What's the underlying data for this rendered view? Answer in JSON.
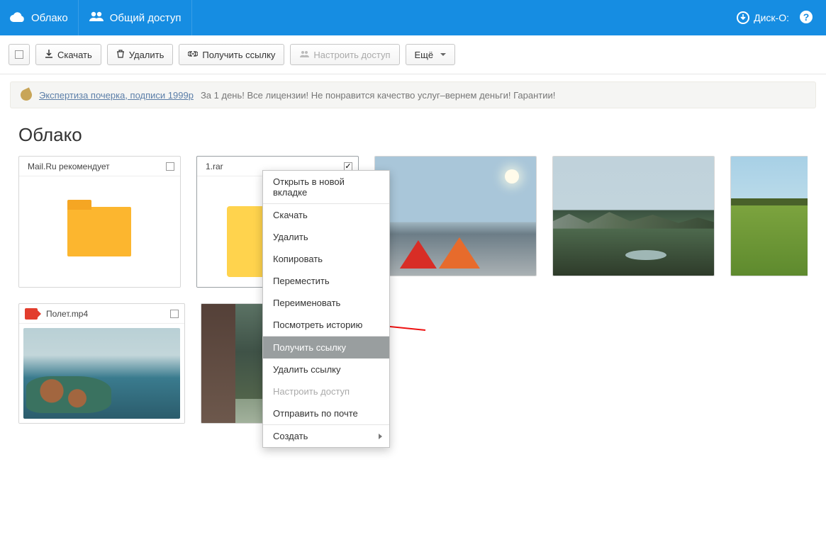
{
  "topbar": {
    "tab_cloud": "Облако",
    "tab_shared": "Общий доступ",
    "disk_label": "Диск-О:"
  },
  "toolbar": {
    "download": "Скачать",
    "delete": "Удалить",
    "getlink": "Получить ссылку",
    "configure_access": "Настроить доступ",
    "more": "Ещё"
  },
  "ad": {
    "link": "Экспертиза почерка, подписи 1999р",
    "text": "За 1 день! Все лицензии! Не понравится качество услуг–вернем деньги! Гарантии!"
  },
  "page_title": "Облако",
  "items": {
    "folder": {
      "title": "Mail.Ru рекомендует"
    },
    "archive": {
      "title": "1.rar"
    },
    "video": {
      "title": "Полет.mp4"
    }
  },
  "context_menu": [
    {
      "label": "Открыть в новой вкладке",
      "state": ""
    },
    {
      "label": "Скачать",
      "state": "sep"
    },
    {
      "label": "Удалить",
      "state": ""
    },
    {
      "label": "Копировать",
      "state": ""
    },
    {
      "label": "Переместить",
      "state": ""
    },
    {
      "label": "Переименовать",
      "state": ""
    },
    {
      "label": "Посмотреть историю",
      "state": ""
    },
    {
      "label": "Получить ссылку",
      "state": "selected sep"
    },
    {
      "label": "Удалить ссылку",
      "state": ""
    },
    {
      "label": "Настроить доступ",
      "state": "disabled"
    },
    {
      "label": "Отправить по почте",
      "state": ""
    },
    {
      "label": "Создать",
      "state": "sep sub"
    }
  ]
}
